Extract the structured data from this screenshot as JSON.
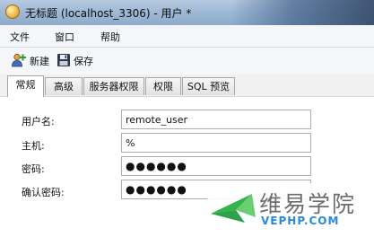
{
  "window": {
    "title": "无标题 (localhost_3306) - 用户 *"
  },
  "menu": [
    {
      "label": "文件"
    },
    {
      "label": "窗口"
    },
    {
      "label": "帮助"
    }
  ],
  "toolbar": {
    "new_label": "新建",
    "save_label": "保存"
  },
  "tabs": [
    {
      "label": "常规",
      "active": true
    },
    {
      "label": "高级",
      "active": false
    },
    {
      "label": "服务器权限",
      "active": false
    },
    {
      "label": "权限",
      "active": false
    },
    {
      "label": "SQL 预览",
      "active": false
    }
  ],
  "form": {
    "username": {
      "label": "用户名:",
      "value": "remote_user"
    },
    "host": {
      "label": "主机:",
      "value": "%"
    },
    "password": {
      "label": "密码:",
      "value": "●●●●●●"
    },
    "confirm_password": {
      "label": "确认密码:",
      "value": "●●●●●●"
    }
  },
  "watermark": {
    "text": "维易学院",
    "url": "VEPHP.COM"
  },
  "colors": {
    "watermark_url": "#2a8ad6",
    "watermark_logo": "#35b34a"
  }
}
